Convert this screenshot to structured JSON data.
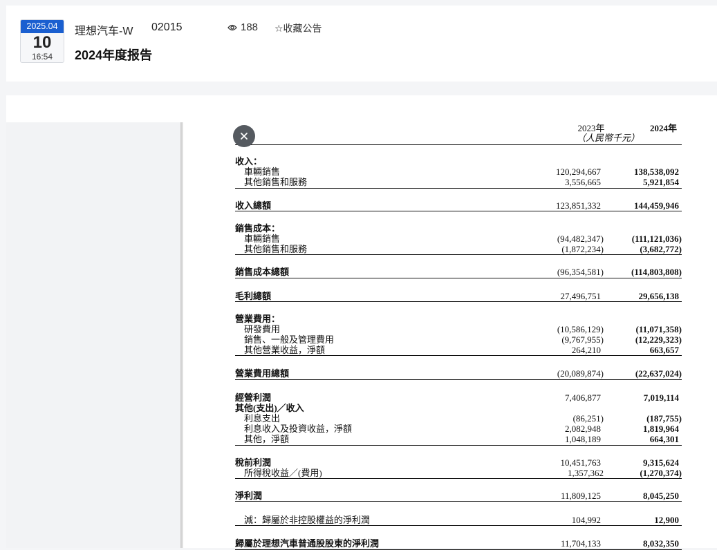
{
  "header": {
    "date_month": "2025.04",
    "date_day": "10",
    "date_time": "16:54",
    "company": "理想汽车-W",
    "code": "02015",
    "views": "188",
    "favorite_label": "☆收藏公告",
    "report_title": "2024年度报告"
  },
  "table": {
    "col_2023": "2023年",
    "col_2024": "2024年",
    "unit": "（人民幣千元）",
    "rows": [
      {
        "label": "收入：",
        "v2023": "",
        "v2024": "",
        "bold": true,
        "gap": 16
      },
      {
        "label": "車輛銷售",
        "v2023": "120,294,667",
        "v2024": "138,538,092",
        "indent": true
      },
      {
        "label": "其他銷售和服務",
        "v2023": "3,556,665",
        "v2024": "5,921,854",
        "indent": true
      },
      {
        "label": "收入總額",
        "v2023": "123,851,332",
        "v2024": "144,459,946",
        "bold": true,
        "gap": 17
      },
      {
        "label": "銷售成本：",
        "v2023": "",
        "v2024": "",
        "bold": true,
        "gap": 17
      },
      {
        "label": "車輛銷售",
        "v2023": "(94,482,347)",
        "v2024": "(111,121,036)",
        "indent": true,
        "neg": true
      },
      {
        "label": "其他銷售和服務",
        "v2023": "(1,872,234)",
        "v2024": "(3,682,772)",
        "indent": true,
        "neg": true
      },
      {
        "label": "銷售成本總額",
        "v2023": "(96,354,581)",
        "v2024": "(114,803,808)",
        "bold": true,
        "neg": true,
        "gap": 17
      },
      {
        "label": "毛利總額",
        "v2023": "27,496,751",
        "v2024": "29,656,138",
        "bold": true,
        "gap": 18
      },
      {
        "label": "營業費用：",
        "v2023": "",
        "v2024": "",
        "bold": true,
        "gap": 17
      },
      {
        "label": "研發費用",
        "v2023": "(10,586,129)",
        "v2024": "(11,071,358)",
        "indent": true,
        "neg": true
      },
      {
        "label": "銷售、一般及管理費用",
        "v2023": "(9,767,955)",
        "v2024": "(12,229,323)",
        "indent": true,
        "neg": true
      },
      {
        "label": "其他營業收益，淨額",
        "v2023": "264,210",
        "v2024": "663,657",
        "indent": true
      },
      {
        "label": "營業費用總額",
        "v2023": "(20,089,874)",
        "v2024": "(22,637,024)",
        "bold": true,
        "neg": true,
        "gap": 18
      },
      {
        "label": "經營利潤",
        "v2023": "7,406,877",
        "v2024": "7,019,114",
        "bold": true,
        "gap": 18
      },
      {
        "label": "其他(支出)／收入",
        "v2023": "",
        "v2024": "",
        "bold": true
      },
      {
        "label": "利息支出",
        "v2023": "(86,251)",
        "v2024": "(187,755)",
        "indent": true,
        "neg": true
      },
      {
        "label": "利息收入及投資收益，淨額",
        "v2023": "2,082,948",
        "v2024": "1,819,964",
        "indent": true
      },
      {
        "label": "其他，淨額",
        "v2023": "1,048,189",
        "v2024": "664,301",
        "indent": true
      },
      {
        "label": "稅前利潤",
        "v2023": "10,451,763",
        "v2024": "9,315,624",
        "bold": true,
        "gap": 17
      },
      {
        "label": "所得稅收益／(費用)",
        "v2023": "1,357,362",
        "v2024": "(1,270,374)",
        "indent": true,
        "neg": true
      },
      {
        "label": "淨利潤",
        "v2023": "11,809,125",
        "v2024": "8,045,250",
        "bold": true,
        "gap": 17
      },
      {
        "label": "減：歸屬於非控股權益的淨利潤",
        "v2023": "104,992",
        "v2024": "12,900",
        "indent": true,
        "gap": 19
      },
      {
        "label": "歸屬於理想汽車普通股股東的淨利潤",
        "v2023": "11,704,133",
        "v2024": "8,032,350",
        "bold": true,
        "gap": 18
      }
    ]
  }
}
